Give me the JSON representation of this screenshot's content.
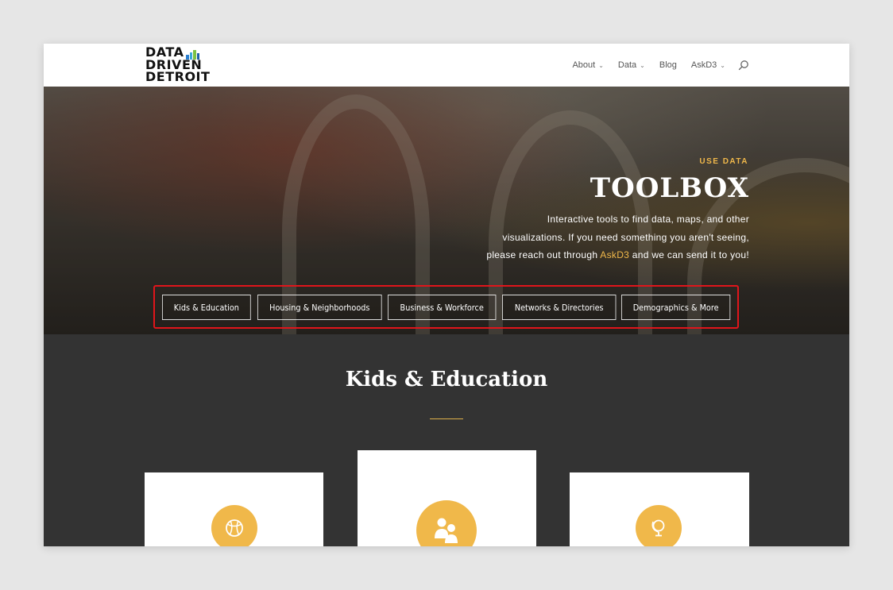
{
  "logo": {
    "lines": [
      "DATA",
      "DRIVEN",
      "DETROIT"
    ],
    "bar_colors": [
      "#2a7fd1",
      "#3aa8d8",
      "#7dc242",
      "#1e5fa8"
    ]
  },
  "nav": {
    "items": [
      {
        "label": "About",
        "has_dropdown": true
      },
      {
        "label": "Data",
        "has_dropdown": true
      },
      {
        "label": "Blog",
        "has_dropdown": false
      },
      {
        "label": "AskD3",
        "has_dropdown": true
      }
    ],
    "chevron_glyph": "⌄",
    "search_icon": "search-icon"
  },
  "hero": {
    "kicker": "USE DATA",
    "title": "TOOLBOX",
    "desc_line1": "Interactive tools to find data, maps, and other",
    "desc_line2": "visualizations.  If you need something you aren't seeing,",
    "desc_line3_pre": "please reach out through ",
    "desc_link": "AskD3",
    "desc_line3_post": " and we can send it to you!",
    "accent_color": "#f0b84a"
  },
  "tabs": [
    {
      "label": "Kids & Education"
    },
    {
      "label": "Housing & Neighborhoods"
    },
    {
      "label": "Business & Workforce"
    },
    {
      "label": "Networks & Directories"
    },
    {
      "label": "Demographics & More"
    }
  ],
  "highlight_color": "#e0151b",
  "section": {
    "title": "Kids & Education"
  },
  "cards": [
    {
      "icon": "basketball-icon"
    },
    {
      "icon": "people-icon"
    },
    {
      "icon": "globe-icon"
    }
  ]
}
